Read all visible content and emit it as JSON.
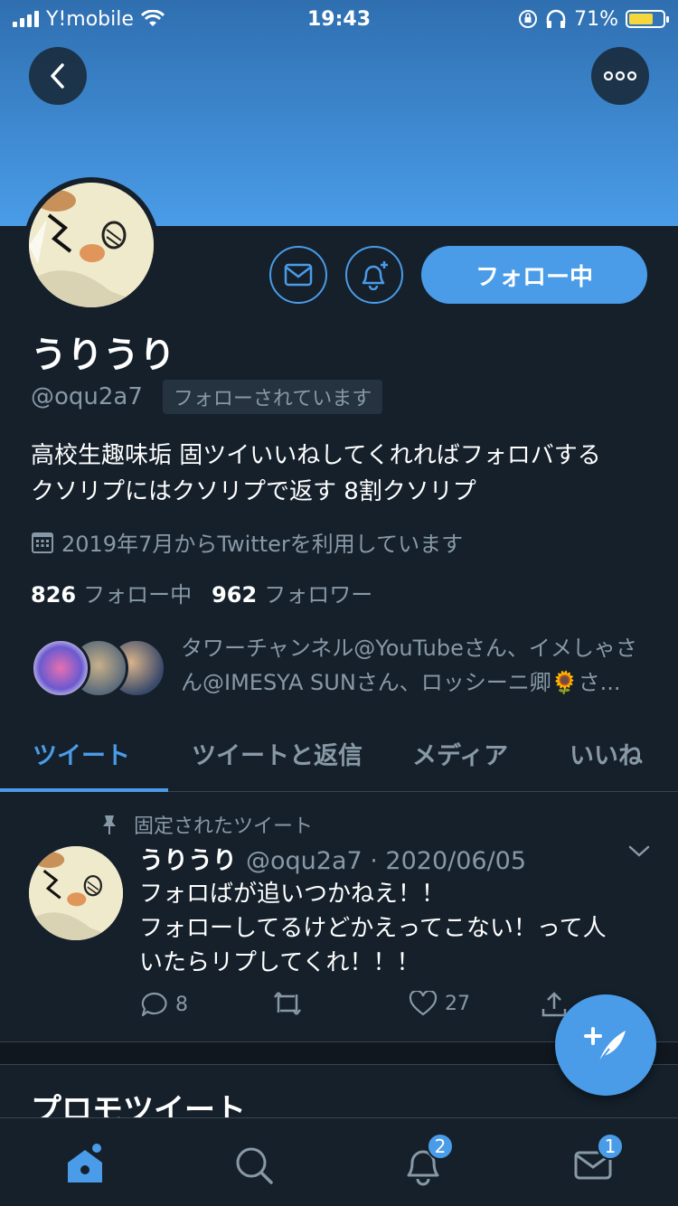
{
  "status_bar": {
    "carrier": "Y!mobile",
    "time": "19:43",
    "battery": "71%",
    "battery_level": 0.71
  },
  "profile": {
    "display_name": "うりうり",
    "handle": "@oqu2a7",
    "follows_you": "フォローされています",
    "follow_button": "フォロー中",
    "bio_line1": "高校生趣味垢 固ツイいいねしてくれればフォロバする",
    "bio_line2": "クソリプにはクソリプで返す 8割クソリプ",
    "joined": "2019年7月からTwitterを利用しています",
    "following_count": "826",
    "following_label": "フォロー中",
    "followers_count": "962",
    "followers_label": "フォロワー",
    "followers_you_know_line1": "タワーチャンネル@YouTubeさん、イメしゃさ",
    "followers_you_know_line2": "ん@IMESYA SUNさん、ロッシーニ卿🌻さ..."
  },
  "tabs": [
    {
      "label": "ツイート"
    },
    {
      "label": "ツイートと返信"
    },
    {
      "label": "メディア"
    },
    {
      "label": "いいね"
    }
  ],
  "pinned_tweet": {
    "pinned_label": "固定されたツイート",
    "name": "うりうり",
    "handle_date": "@oqu2a7 · 2020/06/05",
    "text": "フォロばが追いつかねえ！！\nフォローしてるけどかえってこない！って人\nいたらリプしてくれ！！！",
    "replies": "8",
    "likes": "27"
  },
  "promo_heading": "プロモツイート",
  "bottom_nav": {
    "notifications_badge": "2",
    "messages_badge": "1"
  },
  "colors": {
    "accent": "#4a9ce8",
    "background": "#15202b",
    "muted": "#8899a6"
  }
}
